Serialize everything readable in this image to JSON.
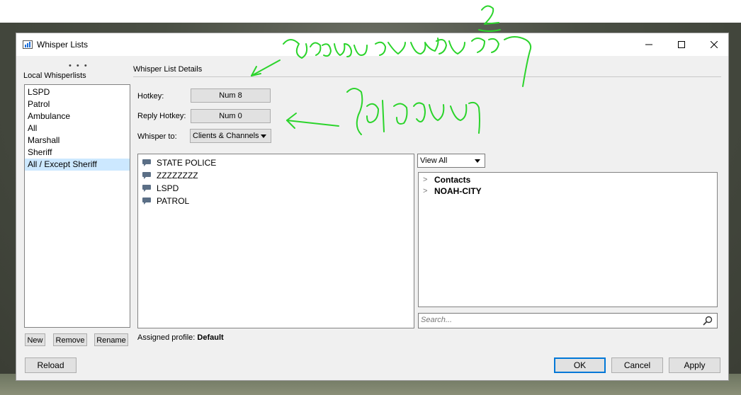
{
  "window": {
    "title": "Whisper Lists",
    "minimize_glyph": "—",
    "maximize_glyph": "☐",
    "close_glyph": "✕"
  },
  "local_lists": {
    "heading": "Local Whisperlists",
    "more_glyph": "• • •",
    "items": [
      "LSPD",
      "Patrol",
      "Ambulance",
      "All",
      "Marshall",
      "Sheriff",
      "All / Except Sheriff"
    ],
    "selected_index": 6,
    "new_label": "New",
    "remove_label": "Remove",
    "rename_label": "Rename"
  },
  "details": {
    "heading": "Whisper List Details",
    "hotkey_label": "Hotkey:",
    "hotkey_value": "Num 8",
    "reply_hotkey_label": "Reply Hotkey:",
    "reply_hotkey_value": "Num 0",
    "whisper_to_label": "Whisper to:",
    "whisper_to_value": "Clients & Channels",
    "channels": [
      "STATE POLICE",
      "ZZZZZZZZ",
      "LSPD",
      "PATROL"
    ],
    "view_filter": "View All",
    "tree": [
      "Contacts",
      "NOAH-CITY"
    ],
    "search_placeholder": "Search...",
    "assigned_profile_label": "Assigned profile:",
    "assigned_profile_value": "Default"
  },
  "footer": {
    "reload_label": "Reload",
    "ok_label": "OK",
    "cancel_label": "Cancel",
    "apply_label": "Apply"
  },
  "annotations": {
    "color": "#2bd42b"
  }
}
